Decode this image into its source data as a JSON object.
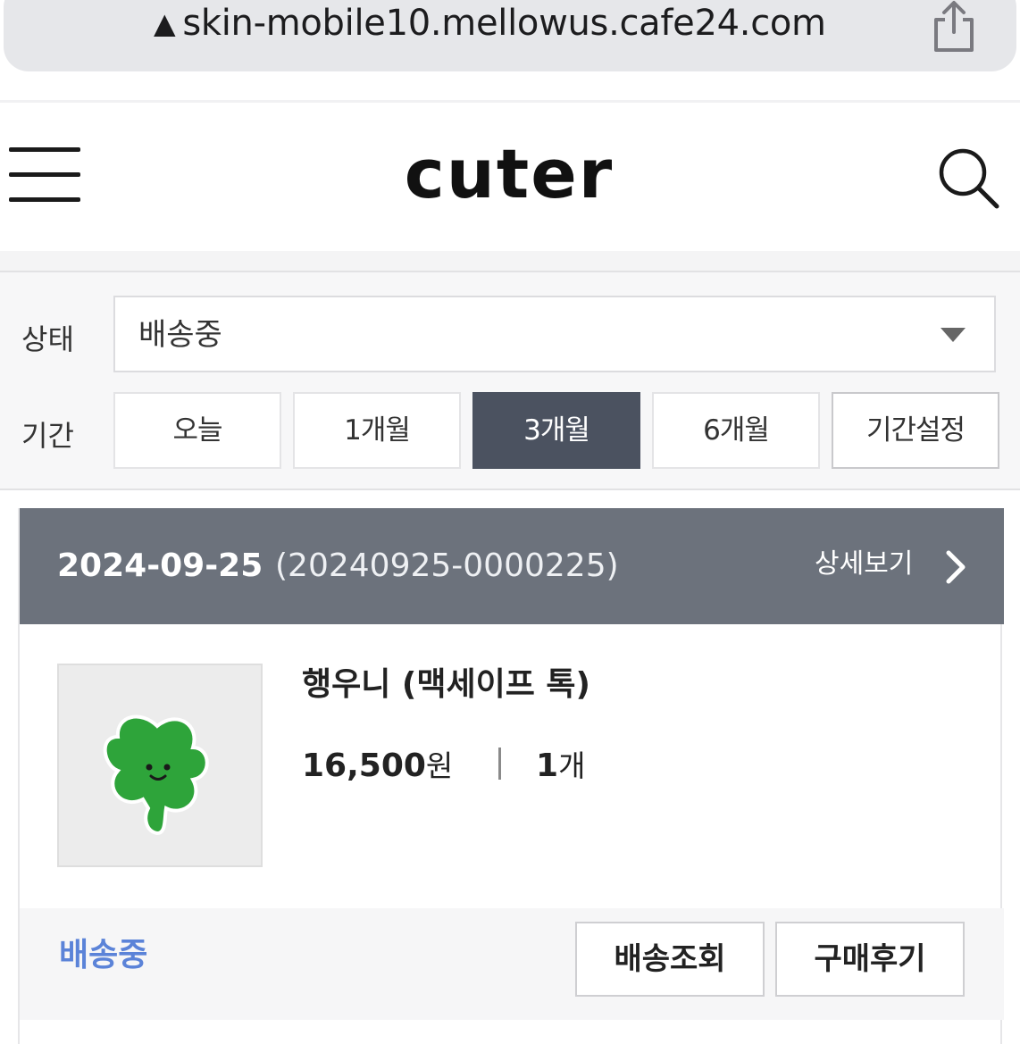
{
  "browser": {
    "url": "skin-mobile10.mellowus.cafe24.com",
    "warning_icon": "warning-triangle-icon",
    "share_icon": "share-icon"
  },
  "header": {
    "logo": "cuter",
    "menu_icon": "hamburger-icon",
    "search_icon": "search-icon"
  },
  "filter": {
    "status_label": "상태",
    "status_value": "배송중",
    "period_label": "기간",
    "periods": [
      "오늘",
      "1개월",
      "3개월",
      "6개월",
      "기간설정"
    ],
    "active_period": "3개월"
  },
  "order": {
    "date": "2024-09-25",
    "order_number": "(20240925-0000225)",
    "detail_label": "상세보기",
    "product": {
      "name": "행우니 (맥세이프 톡)",
      "price": "16,500",
      "price_unit": "원",
      "quantity": "1",
      "quantity_unit": "개",
      "image_icon": "green-clover-character"
    },
    "shipping_status": "배송중",
    "track_button": "배송조회",
    "review_button": "구매후기"
  },
  "colors": {
    "active_period_bg": "#4b5260",
    "order_header_bg": "#6c727c",
    "shipping_status": "#5b83d8",
    "clover_green": "#2ea43a"
  }
}
